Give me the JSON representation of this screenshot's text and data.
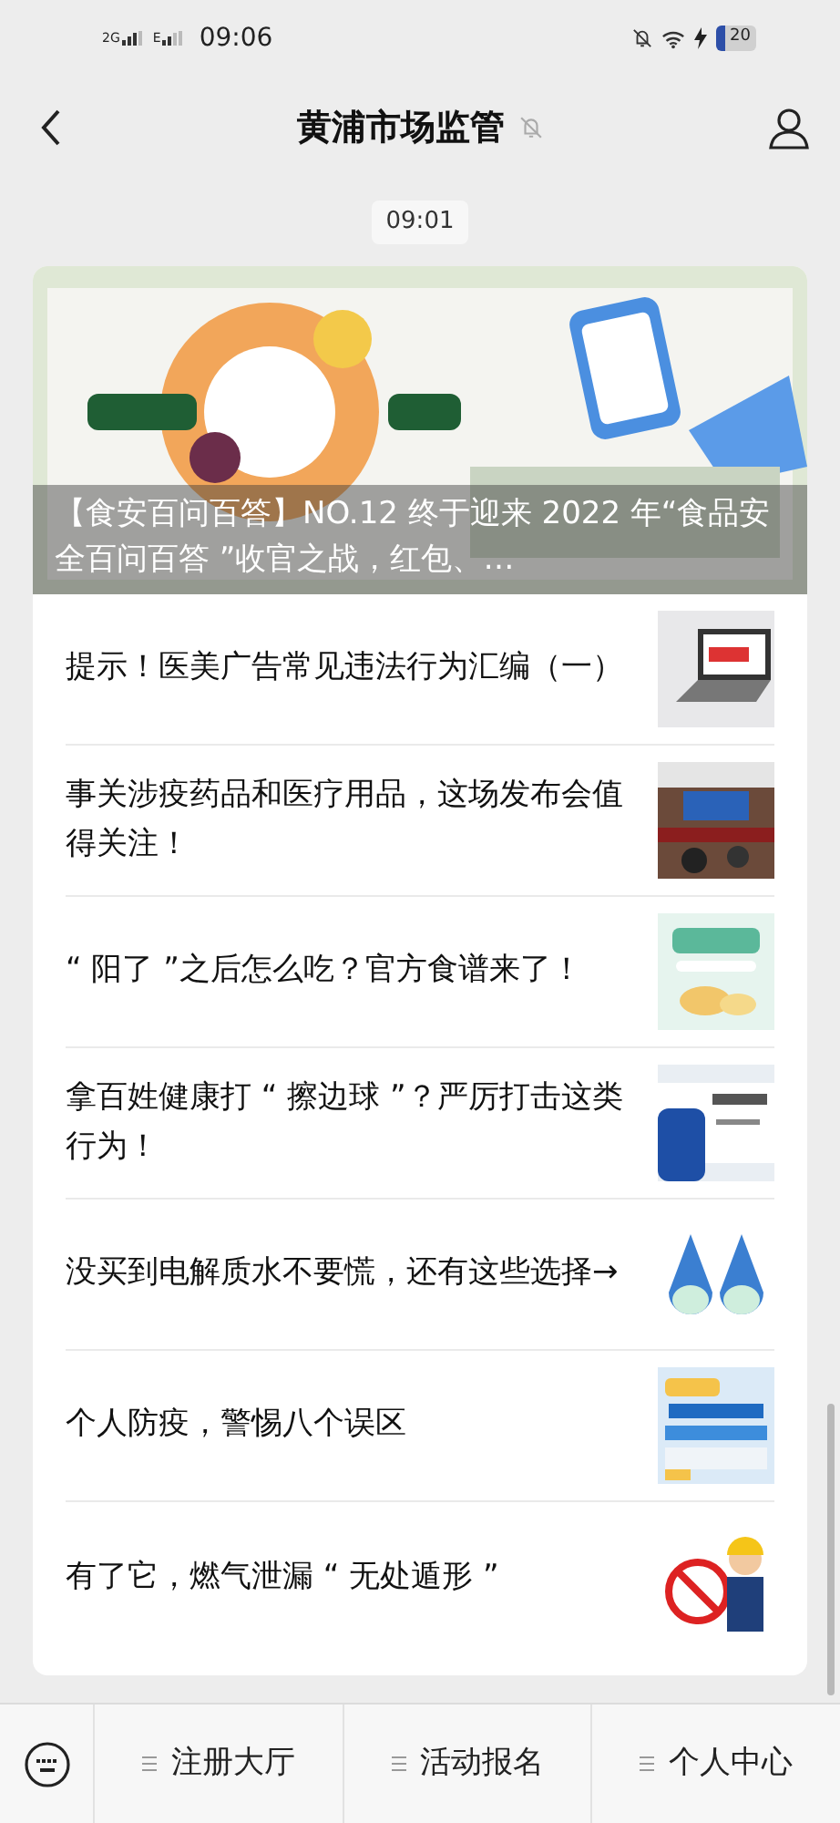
{
  "status_bar": {
    "network_1": "2G",
    "network_2": "E",
    "time": "09:06",
    "battery": "20"
  },
  "header": {
    "title": "黄浦市场监管",
    "muted": true
  },
  "timestamp": "09:01",
  "lead_article": {
    "title": "【食安百问百答】NO.12  终于迎来 2022 年“食品安全百问百答 ”收官之战，红包、…"
  },
  "articles": [
    {
      "title": "提示！医美广告常见违法行为汇编（一）",
      "kind": "picture"
    },
    {
      "title": "事关涉疫药品和医疗用品，这场发布会值得关注！",
      "kind": "picture"
    },
    {
      "title": "“ 阳了 ”之后怎么吃？官方食谱来了！",
      "kind": "picture"
    },
    {
      "title": "拿百姓健康打 “ 擦边球 ”？严厉打击这类行为！",
      "kind": "picture"
    },
    {
      "title": "没买到电解质水不要慌，还有这些选择→",
      "kind": "picture"
    },
    {
      "title": "个人防疫，警惕八个误区",
      "kind": "picture"
    },
    {
      "title": "有了它，燃气泄漏 “ 无处遁形 ”",
      "kind": "picture"
    }
  ],
  "menu": [
    "注册大厅",
    "活动报名",
    "个人中心"
  ]
}
